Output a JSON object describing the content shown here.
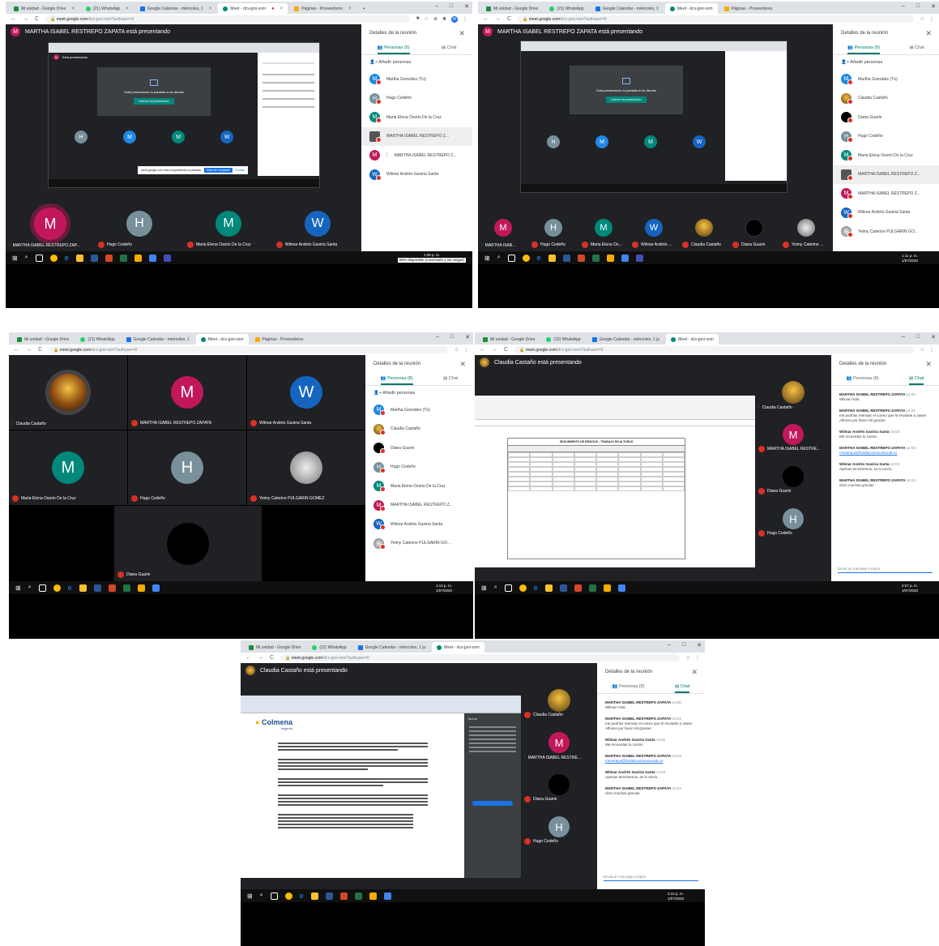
{
  "colors": {
    "magenta": "#c2185b",
    "grey": "#78909c",
    "teal": "#00897b",
    "blue": "#1e88e5",
    "brand_blue": "#1565c0",
    "green": "#1e8e3e",
    "red": "#d93025",
    "accent_teal": "#00796b"
  },
  "browser": {
    "tabs": [
      {
        "label": "Mi unidad - Google Drive",
        "icon": "drive-icon"
      },
      {
        "label": "(21) WhatsApp",
        "icon": "whatsapp-icon"
      },
      {
        "label": "Google Calendar - miércoles, 1",
        "icon": "calendar-icon"
      },
      {
        "label": "Meet - dcv-jpni-sxm",
        "icon": "meet-icon"
      },
      {
        "label": "Páginas - Proveedores",
        "icon": "pages-icon"
      }
    ],
    "tabs_alt_whatsapp": "(12) WhatsApp",
    "tabs_alt_calendar": "Google Calendar - miércoles, 1 ju",
    "url": "meet.google.com",
    "url_path": "/dcv-jpni-sxm?authuser=0"
  },
  "presenting": {
    "martha": "MARTHA ISABEL RESTREPO ZAPATA está presentando",
    "claudia": "Claudia Castaño está presentando",
    "you_are_presenting": "Está presentando",
    "share_msg": "Está presentando tu pantalla a los demás",
    "stop_btn": "Detener la presentación",
    "share_banner": "meet.google.com está compartiendo tu pantalla",
    "share_stop": "Dejar de compartir",
    "share_hide": "Ocultar"
  },
  "panel": {
    "title": "Detalles de la reunión",
    "people_tab_6": "Personas (6)",
    "people_tab_9": "Personas (9)",
    "people_tab_8": "Personas (8)",
    "chat_tab": "Chat",
    "add_people": "Añadir personas",
    "chat_placeholder": "Envía un mensaje a todos"
  },
  "people_6": [
    {
      "name": "Martha González (Tú)",
      "initial": "M",
      "color": "#1e88e5"
    },
    {
      "name": "Hugo Cedeño",
      "initial": "H",
      "color": "#78909c"
    },
    {
      "name": "Maria Elena Osorio De la Cruz",
      "initial": "M",
      "color": "#00897b"
    },
    {
      "name": "MARTHA ISABEL RESTREPO Z...",
      "initial": "",
      "color": "#555555"
    },
    {
      "name": "MARTHA ISABEL RESTREPO Z...",
      "initial": "M",
      "color": "#c2185b"
    },
    {
      "name": "Wilmar Andrés Gaviria Santa",
      "initial": "W",
      "color": "#1565c0"
    }
  ],
  "people_9": [
    {
      "name": "Martha González (Tú)",
      "initial": "M",
      "color": "#1e88e5"
    },
    {
      "name": "Claudia Castaño",
      "initial": "",
      "color": "#e0a030"
    },
    {
      "name": "Diana Guarin",
      "initial": "",
      "color": "#000000"
    },
    {
      "name": "Hugo Cedeño",
      "initial": "H",
      "color": "#78909c"
    },
    {
      "name": "Maria Elena Osorio De la Cruz",
      "initial": "M",
      "color": "#00897b"
    },
    {
      "name": "MARTHA ISABEL RESTREPO Z...",
      "initial": "",
      "color": "#555555"
    },
    {
      "name": "MARTHA ISABEL RESTREPO Z...",
      "initial": "M",
      "color": "#c2185b"
    },
    {
      "name": "Wilmar Andrés Gaviria Santa",
      "initial": "W",
      "color": "#1565c0"
    },
    {
      "name": "Yeimy Caterine PULGARIN GO...",
      "initial": "",
      "color": "#cccccc"
    }
  ],
  "people_8": [
    {
      "name": "Martha González (Tú)",
      "initial": "M",
      "color": "#1e88e5"
    },
    {
      "name": "Claudia Castaño",
      "initial": "",
      "color": "#e0a030"
    },
    {
      "name": "Diana Guarin",
      "initial": "",
      "color": "#000000"
    },
    {
      "name": "Hugo Cedeño",
      "initial": "H",
      "color": "#78909c"
    },
    {
      "name": "Maria Elena Osorio De la Cruz",
      "initial": "M",
      "color": "#00897b"
    },
    {
      "name": "MARTHA ISABEL RESTREPO Z...",
      "initial": "M",
      "color": "#c2185b"
    },
    {
      "name": "Wilmar Andrés Gaviria Santa",
      "initial": "W",
      "color": "#1565c0"
    },
    {
      "name": "Yeimy Caterine PULGARIN GO...",
      "initial": "",
      "color": "#cccccc"
    }
  ],
  "tiles_1": [
    {
      "name": "MARTHA ISABEL RESTREPO ZAP...",
      "initial": "M",
      "color": "#c2185b"
    },
    {
      "name": "Hugo Cedeño",
      "initial": "H",
      "color": "#78909c"
    },
    {
      "name": "Maria Elena Osorio De la Cruz",
      "initial": "M",
      "color": "#00897b"
    },
    {
      "name": "Wilmar Andrés Gaviria Santa",
      "initial": "W",
      "color": "#1565c0"
    }
  ],
  "tiles_2": [
    {
      "name": "MARTHA ISAB...",
      "initial": "M",
      "color": "#c2185b"
    },
    {
      "name": "Hugo Cedeño",
      "initial": "H",
      "color": "#78909c"
    },
    {
      "name": "Maria Elena Os...",
      "initial": "M",
      "color": "#00897b"
    },
    {
      "name": "Wilmar Andrés ...",
      "initial": "W",
      "color": "#1565c0"
    },
    {
      "name": "Claudia Castaño",
      "initial": "",
      "color": "#e0a030"
    },
    {
      "name": "Diana Guarin",
      "initial": "",
      "color": "#000000"
    },
    {
      "name": "Yeimy Caterine ...",
      "initial": "",
      "color": "#cccccc"
    }
  ],
  "tiles_3": [
    {
      "name": "Claudia Castaño",
      "initial": "",
      "color": "#e0a030"
    },
    {
      "name": "MARTHA ISABEL RESTREPO ZAPATA",
      "initial": "M",
      "color": "#c2185b"
    },
    {
      "name": "Wilmar Andrés Gaviria Santa",
      "initial": "W",
      "color": "#1565c0"
    },
    {
      "name": "Maria Elena Osorio De la Cruz",
      "initial": "M",
      "color": "#00897b"
    },
    {
      "name": "Hugo Cedeño",
      "initial": "H",
      "color": "#78909c"
    },
    {
      "name": "Yeimy Caterine PULGARIN GOMEZ",
      "initial": "",
      "color": "#cccccc"
    },
    {
      "name": "Diana Guarin",
      "initial": "",
      "color": "#000000"
    }
  ],
  "side_tiles": [
    {
      "name": "Claudia Castaño",
      "initial": "",
      "color": "#e0a030"
    },
    {
      "name": "MARTHA ISABEL RESTRE...",
      "initial": "M",
      "color": "#c2185b"
    },
    {
      "name": "Diana Guarin",
      "initial": "",
      "color": "#000000"
    },
    {
      "name": "Hugo Cedeño",
      "initial": "H",
      "color": "#78909c"
    }
  ],
  "chat": [
    {
      "who": "MARTHA ISABEL RESTREPO ZAPATA",
      "time": "14:00",
      "text": "Wilmar Hola"
    },
    {
      "who": "MARTHA ISABEL RESTREPO ZAPATA",
      "time": "14:01",
      "text": "me podrías reenviar el correo que le enviaste a Javier Alfonso por favor mil gracias"
    },
    {
      "who": "Wilmar Andrés Gaviria Santa",
      "time": "14:02",
      "text": "Me recuerdas tu correo"
    },
    {
      "who": "MARTHA ISABEL RESTREPO ZAPATA",
      "time": "14:03",
      "text": "mrestrepo@fundacionesussocial.co",
      "link": true
    },
    {
      "who": "Wilmar Andrés Gaviria Santa",
      "time": "14:03",
      "text": "Apenas terminemos, se lo envío."
    },
    {
      "who": "MARTHA ISABEL RESTREPO ZAPATA",
      "time": "14:04",
      "text": "claro muchas gracias"
    }
  ],
  "clock": {
    "t1": "1:09 p. m.",
    "t2": "1:11 p. m.",
    "t3": "1:12 p. m.",
    "t4": "2:07 p. m.",
    "t5": "2:12 p. m.",
    "date": "1/07/2020",
    "battery_tip": "80% disponible (conectado y sin cargar)"
  },
  "doc": {
    "brand": "Colmena",
    "brand_sub": "seguros",
    "side_header": "Tareas",
    "sheet_title": "SEGUIMIENTO DE RIESGOS - TRABAJO EN ALTURAS"
  }
}
